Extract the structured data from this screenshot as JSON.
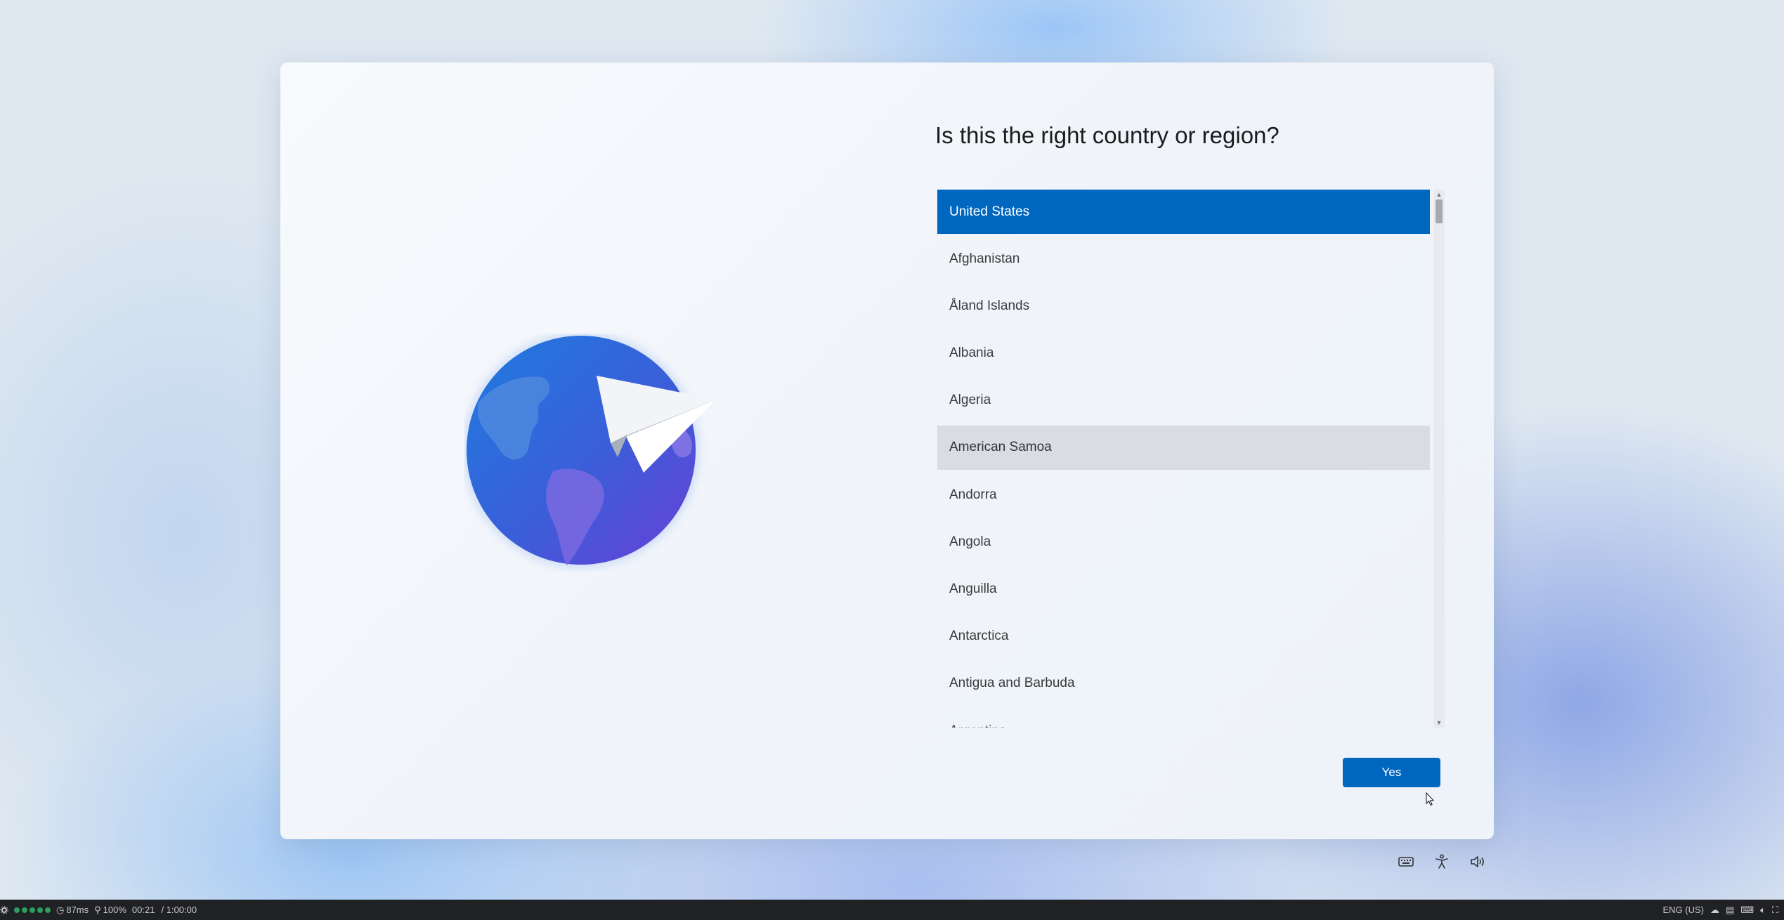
{
  "dialog": {
    "title": "Is this the right country or region?",
    "countries": [
      "United States",
      "Afghanistan",
      "Åland Islands",
      "Albania",
      "Algeria",
      "American Samoa",
      "Andorra",
      "Angola",
      "Anguilla",
      "Antarctica",
      "Antigua and Barbuda",
      "Argentina"
    ],
    "selected_country": "United States",
    "hovered_country": "American Samoa",
    "yes_label": "Yes"
  },
  "system_icons": [
    "keyboard-icon",
    "accessibility-icon",
    "volume-icon"
  ],
  "statusbar": {
    "latency": "87ms",
    "zoom": "100%",
    "elapsed": "00:21",
    "duration": "/ 1:00:00",
    "language": "ENG (US)"
  },
  "colors": {
    "accent": "#0067c0",
    "hover": "#d9dce3",
    "statusbar_bg": "#202124",
    "status_dot": "#2e9e5e"
  }
}
